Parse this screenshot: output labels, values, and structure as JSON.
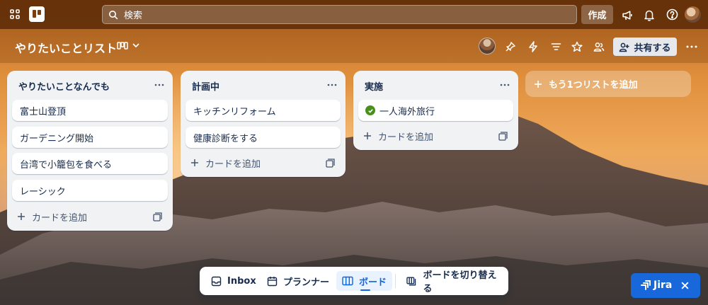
{
  "topbar": {
    "search_placeholder": "検索",
    "create_label": "作成"
  },
  "board": {
    "title": "やりたいことリスト",
    "share_label": "共有する"
  },
  "lists": [
    {
      "title": "やりたいことなんでも",
      "cards": [
        "富士山登頂",
        "ガーデニング開始",
        "台湾で小籠包を食べる",
        "レーシック"
      ],
      "add_card_label": "カードを追加"
    },
    {
      "title": "計画中",
      "cards": [
        "キッチンリフォーム",
        "健康診断をする"
      ],
      "add_card_label": "カードを追加"
    },
    {
      "title": "実施",
      "cards": [
        "一人海外旅行"
      ],
      "completed": [
        true
      ],
      "add_card_label": "カードを追加"
    }
  ],
  "add_list_label": "もう1つリストを追加",
  "switcher": {
    "inbox": "Inbox",
    "planner": "プランナー",
    "board": "ボード",
    "switch_board": "ボードを切り替える",
    "active": "board"
  },
  "jira": {
    "label": "Jira"
  },
  "colors": {
    "accent": "#0c66e4",
    "jira_blue": "#1868db",
    "done_green": "#4a8f1e",
    "list_bg": "#f1f2f4"
  }
}
